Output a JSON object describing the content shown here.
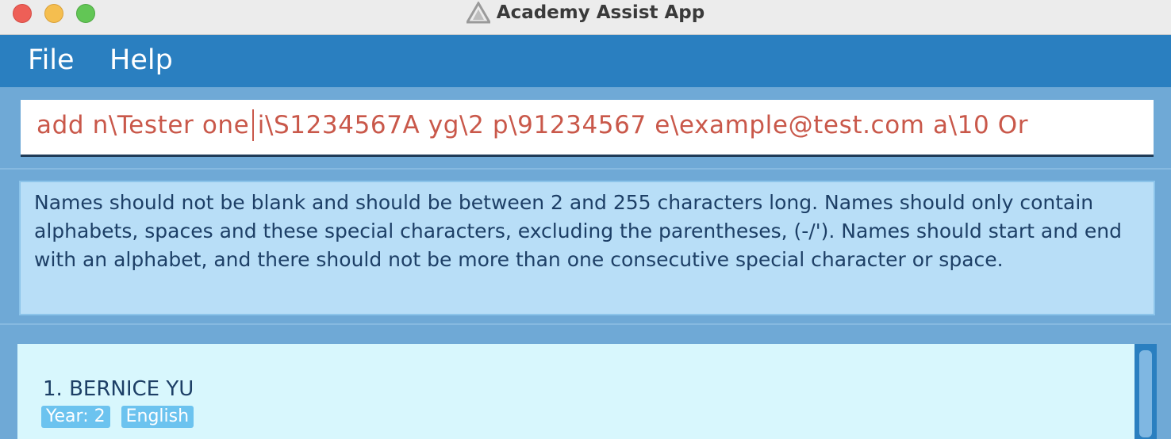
{
  "window": {
    "title": "Academy Assist App"
  },
  "menu": {
    "items": [
      {
        "label": "File"
      },
      {
        "label": "Help"
      }
    ]
  },
  "command_box": {
    "value": "add n\\Tester  one i\\S1234567A yg\\2 p\\91234567 e\\example@test.com a\\10 Or"
  },
  "result_display": {
    "text": "Names should not be blank and should be between 2 and 255 characters long. Names should only contain alphabets, spaces and these special characters, excluding the parentheses, (-/'). Names should start and end with an alphabet, and there should not be more than one consecutive special character or space."
  },
  "person_list": {
    "items": [
      {
        "index_name": "1. BERNICE YU",
        "tags": [
          "Year: 2",
          "English"
        ]
      }
    ]
  },
  "colors": {
    "menubar": "#2a7fc0",
    "background": "#6fa9d6",
    "command_text": "#c9584a",
    "result_bg": "#b8def7",
    "list_bg": "#d8f7fd",
    "tag_bg": "#6cc3ef"
  }
}
